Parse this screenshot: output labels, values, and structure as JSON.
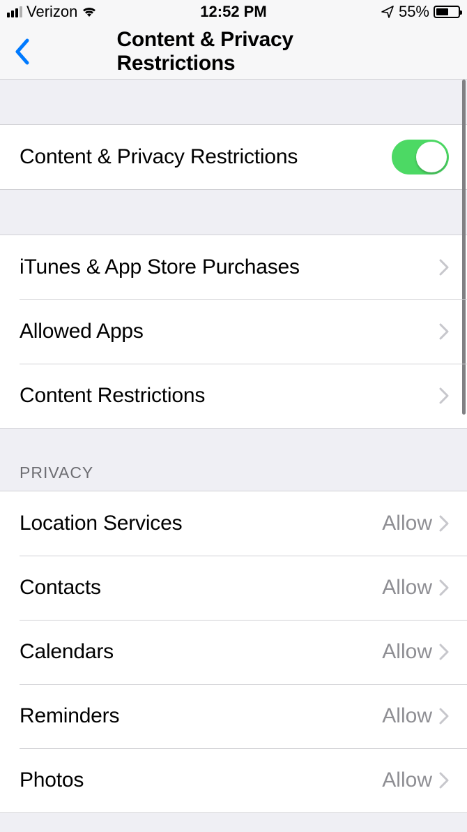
{
  "status": {
    "carrier": "Verizon",
    "time": "12:52 PM",
    "battery_percent": "55%"
  },
  "nav": {
    "title": "Content & Privacy Restrictions"
  },
  "toggle": {
    "label": "Content & Privacy Restrictions",
    "on": true
  },
  "section1": [
    {
      "label": "iTunes & App Store Purchases"
    },
    {
      "label": "Allowed Apps"
    },
    {
      "label": "Content Restrictions"
    }
  ],
  "privacy_header": "PRIVACY",
  "privacy": [
    {
      "label": "Location Services",
      "value": "Allow"
    },
    {
      "label": "Contacts",
      "value": "Allow"
    },
    {
      "label": "Calendars",
      "value": "Allow"
    },
    {
      "label": "Reminders",
      "value": "Allow"
    },
    {
      "label": "Photos",
      "value": "Allow"
    }
  ]
}
